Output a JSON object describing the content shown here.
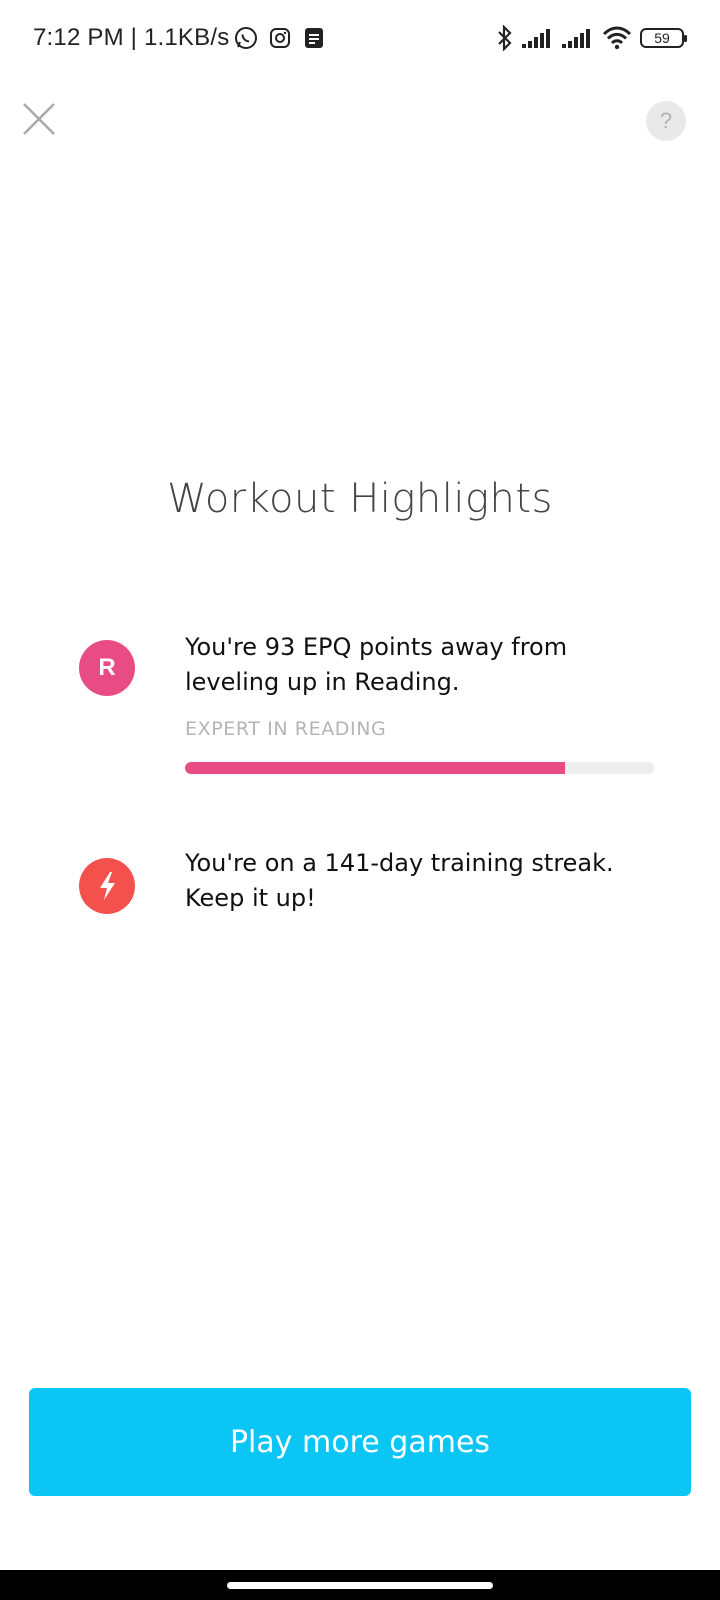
{
  "status_bar": {
    "time": "7:12 PM | 1.1KB/s",
    "battery": "59",
    "icons": [
      "whatsapp-icon",
      "instagram-icon",
      "document-icon",
      "bluetooth-icon",
      "signal-icon",
      "signal-icon",
      "wifi-icon",
      "battery-icon"
    ]
  },
  "header": {
    "close_icon": "close-icon",
    "help_label": "?"
  },
  "title": "Workout Highlights",
  "highlights": [
    {
      "badge": "R",
      "badge_color": "#e94b83",
      "text": "You're 93 EPQ points away from leveling up in Reading.",
      "level_label": "EXPERT IN READING",
      "progress": 0.81
    },
    {
      "badge_icon": "lightning-icon",
      "badge_color": "#f4514c",
      "text": "You're on a 141-day training streak. Keep it up!"
    }
  ],
  "cta": {
    "label": "Play more games",
    "color": "#0bc6f4"
  }
}
